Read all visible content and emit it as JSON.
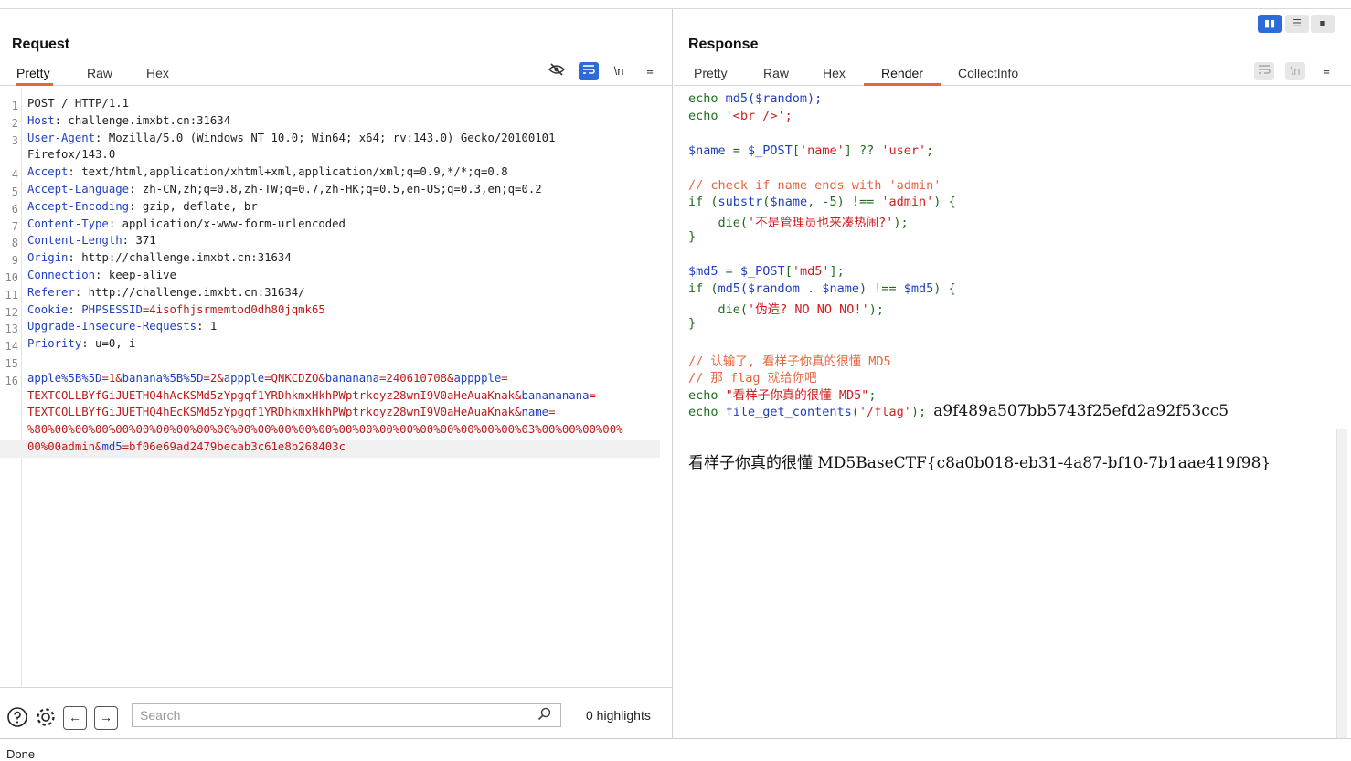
{
  "request": {
    "title": "Request",
    "tabs": [
      "Pretty",
      "Raw",
      "Hex"
    ],
    "active_tab": "Pretty",
    "tools": {
      "hide_icon": "eye-slash-icon",
      "wrap_icon": "wrap-icon",
      "newline_label": "\\n",
      "menu_icon": "menu-icon"
    },
    "lines": [
      {
        "n": "1",
        "parts": [
          [
            "POST / HTTP/1.1",
            "pk"
          ]
        ]
      },
      {
        "n": "2",
        "parts": [
          [
            "Host",
            "hk"
          ],
          [
            ": challenge.imxbt.cn:31634",
            "pk"
          ]
        ]
      },
      {
        "n": "3",
        "parts": [
          [
            "User-Agent",
            "hk"
          ],
          [
            ": Mozilla/5.0 (Windows NT 10.0; Win64; x64; rv:143.0) Gecko/20100101",
            "pk"
          ]
        ]
      },
      {
        "n": "",
        "parts": [
          [
            "Firefox/143.0",
            "pk"
          ]
        ]
      },
      {
        "n": "4",
        "parts": [
          [
            "Accept",
            "hk"
          ],
          [
            ": text/html,application/xhtml+xml,application/xml;q=0.9,*/*;q=0.8",
            "pk"
          ]
        ]
      },
      {
        "n": "5",
        "parts": [
          [
            "Accept-Language",
            "hk"
          ],
          [
            ": zh-CN,zh;q=0.8,zh-TW;q=0.7,zh-HK;q=0.5,en-US;q=0.3,en;q=0.2",
            "pk"
          ]
        ]
      },
      {
        "n": "6",
        "parts": [
          [
            "Accept-Encoding",
            "hk"
          ],
          [
            ": gzip, deflate, br",
            "pk"
          ]
        ]
      },
      {
        "n": "7",
        "parts": [
          [
            "Content-Type",
            "hk"
          ],
          [
            ": application/x-www-form-urlencoded",
            "pk"
          ]
        ]
      },
      {
        "n": "8",
        "parts": [
          [
            "Content-Length",
            "hk"
          ],
          [
            ": 371",
            "pk"
          ]
        ]
      },
      {
        "n": "9",
        "parts": [
          [
            "Origin",
            "hk"
          ],
          [
            ": http://challenge.imxbt.cn:31634",
            "pk"
          ]
        ]
      },
      {
        "n": "10",
        "parts": [
          [
            "Connection",
            "hk"
          ],
          [
            ": keep-alive",
            "pk"
          ]
        ]
      },
      {
        "n": "11",
        "parts": [
          [
            "Referer",
            "hk"
          ],
          [
            ": http://challenge.imxbt.cn:31634/",
            "pk"
          ]
        ]
      },
      {
        "n": "12",
        "parts": [
          [
            "Cookie",
            "hk"
          ],
          [
            ": ",
            "pk"
          ],
          [
            "PHPSESSID",
            "hk"
          ],
          [
            "=4isofhjsrmemtod0dh80jqmk65",
            "pv"
          ]
        ]
      },
      {
        "n": "13",
        "parts": [
          [
            "Upgrade-Insecure-Requests",
            "hk"
          ],
          [
            ": 1",
            "pk"
          ]
        ]
      },
      {
        "n": "14",
        "parts": [
          [
            "Priority",
            "hk"
          ],
          [
            ": u=0, i",
            "pk"
          ]
        ]
      },
      {
        "n": "15",
        "parts": []
      },
      {
        "n": "16",
        "parts": [
          [
            "apple%5B%5D",
            "hk"
          ],
          [
            "=1&",
            "pv"
          ],
          [
            "banana%5B%5D",
            "hk"
          ],
          [
            "=2&",
            "pv"
          ],
          [
            "appple",
            "hk"
          ],
          [
            "=QNKCDZO&",
            "pv"
          ],
          [
            "bananana",
            "hk"
          ],
          [
            "=240610708&",
            "pv"
          ],
          [
            "apppple",
            "hk"
          ],
          [
            "=",
            "pv"
          ]
        ]
      },
      {
        "n": "",
        "parts": [
          [
            "TEXTCOLLBYfGiJUETHQ4hAcKSMd5zYpgqf1YRDhkmxHkhPWptrkoyz28wnI9V0aHeAuaKnak&",
            "pv"
          ],
          [
            "banananana",
            "hk"
          ],
          [
            "=",
            "pv"
          ]
        ]
      },
      {
        "n": "",
        "parts": [
          [
            "TEXTCOLLBYfGiJUETHQ4hEcKSMd5zYpgqf1YRDhkmxHkhPWptrkoyz28wnI9V0aHeAuaKnak&",
            "pv"
          ],
          [
            "name",
            "hk"
          ],
          [
            "=",
            "pv"
          ]
        ]
      },
      {
        "n": "",
        "parts": [
          [
            "%80%00%00%00%00%00%00%00%00%00%00%00%00%00%00%00%00%00%00%00%00%00%00%00%03%00%00%00%00%",
            "pv"
          ]
        ]
      },
      {
        "n": "",
        "parts": [
          [
            "00%00admin&",
            "pv"
          ],
          [
            "md5",
            "hk"
          ],
          [
            "=bf06e69ad2479becab3c61e8b268403c",
            "pv"
          ]
        ],
        "highlight": true
      }
    ],
    "search": {
      "placeholder": "Search"
    },
    "highlights": "0 highlights"
  },
  "response": {
    "title": "Response",
    "tabs": [
      "Pretty",
      "Raw",
      "Hex",
      "Render",
      "CollectInfo"
    ],
    "active_tab": "Render",
    "tools": {
      "wrap_icon": "wrap-icon",
      "newline_label": "\\n",
      "menu_icon": "menu-icon"
    },
    "code": [
      [
        [
          "echo ",
          "c-plain"
        ],
        [
          "md5",
          "c-var"
        ],
        [
          "($random);",
          "c-var"
        ]
      ],
      [
        [
          "echo ",
          "c-plain"
        ],
        [
          "'<br />';",
          "c-str"
        ]
      ],
      [],
      [
        [
          "$name",
          "c-var"
        ],
        [
          " = ",
          "c-op"
        ],
        [
          "$_POST",
          "c-var"
        ],
        [
          "[",
          "c-op"
        ],
        [
          "'name'",
          "c-str"
        ],
        [
          "] ?? ",
          "c-op"
        ],
        [
          "'user'",
          "c-str"
        ],
        [
          ";",
          "c-op"
        ]
      ],
      [],
      [
        [
          "// check if name ends with 'admin'",
          "c-cm"
        ]
      ],
      [
        [
          "if (",
          "c-plain"
        ],
        [
          "substr",
          "c-var"
        ],
        [
          "(",
          "c-op"
        ],
        [
          "$name",
          "c-var"
        ],
        [
          ", -5) !== ",
          "c-op"
        ],
        [
          "'admin'",
          "c-str"
        ],
        [
          ") {",
          "c-op"
        ]
      ],
      [
        [
          "    die(",
          "c-plain"
        ],
        [
          "'不是管理员也来凑热闹?'",
          "c-str"
        ],
        [
          ");",
          "c-op"
        ]
      ],
      [
        [
          "}",
          "c-op"
        ]
      ],
      [],
      [
        [
          "$md5",
          "c-var"
        ],
        [
          " = ",
          "c-op"
        ],
        [
          "$_POST",
          "c-var"
        ],
        [
          "[",
          "c-op"
        ],
        [
          "'md5'",
          "c-str"
        ],
        [
          "];",
          "c-op"
        ]
      ],
      [
        [
          "if (",
          "c-plain"
        ],
        [
          "md5",
          "c-var"
        ],
        [
          "($random . $name)",
          "c-var"
        ],
        [
          " !== ",
          "c-op"
        ],
        [
          "$md5",
          "c-var"
        ],
        [
          ") {",
          "c-op"
        ]
      ],
      [
        [
          "    die(",
          "c-plain"
        ],
        [
          "'伪造? NO NO NO!'",
          "c-str"
        ],
        [
          ");",
          "c-op"
        ]
      ],
      [
        [
          "}",
          "c-op"
        ]
      ],
      [],
      [
        [
          "// 认输了, 看样子你真的很懂 MD5",
          "c-cm"
        ]
      ],
      [
        [
          "// 那 flag 就给你吧",
          "c-cm"
        ]
      ],
      [
        [
          "echo ",
          "c-plain"
        ],
        [
          "\"看样子你真的很懂 MD5\"",
          "c-str"
        ],
        [
          ";",
          "c-op"
        ]
      ],
      [
        [
          "echo ",
          "c-plain"
        ],
        [
          "file_get_contents",
          "c-var"
        ],
        [
          "(",
          "c-op"
        ],
        [
          "'/flag'",
          "c-str"
        ],
        [
          "); ",
          "c-op"
        ],
        [
          "a9f489a507bb5743f25efd2a92f53cc5",
          "out"
        ]
      ]
    ],
    "output_line": "看样子你真的很懂 MD5BaseCTF{c8a0b018-eb31-4a87-bf10-7b1aae419f98}"
  },
  "layout_buttons": [
    "split-horizontal-icon",
    "split-vertical-icon",
    "single-pane-icon"
  ],
  "status": "Done"
}
